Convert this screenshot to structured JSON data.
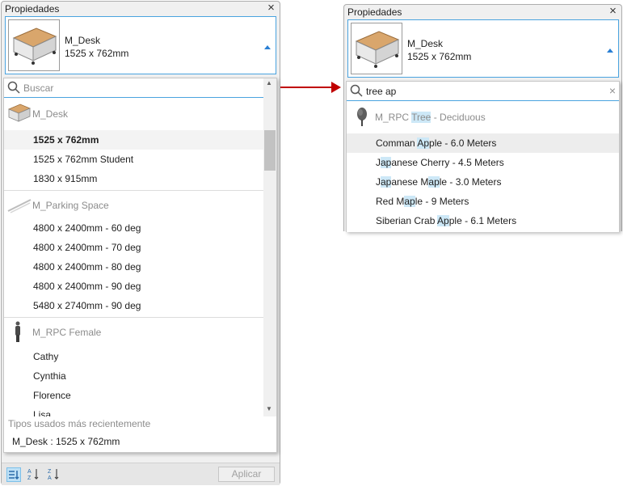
{
  "left": {
    "title": "Propiedades",
    "selected_family": "M_Desk",
    "selected_size": "1525 x 762mm",
    "search_placeholder": "Buscar",
    "groups": [
      {
        "name": "M_Desk",
        "icon": "desk-icon",
        "items": [
          "1525 x 762mm",
          "1525 x 762mm Student",
          "1830 x 915mm"
        ]
      },
      {
        "name": "M_Parking Space",
        "icon": "parking-space-icon",
        "items": [
          "4800 x 2400mm - 60 deg",
          "4800 x 2400mm - 70 deg",
          "4800 x 2400mm - 80 deg",
          "4800 x 2400mm - 90 deg",
          "5480 x 2740mm - 90 deg"
        ]
      },
      {
        "name": "M_RPC Female",
        "icon": "person-icon",
        "items": [
          "Cathy",
          "Cynthia",
          "Florence",
          "Lisa"
        ]
      }
    ],
    "recent_title": "Tipos usados más recientemente",
    "recent_item": "M_Desk : 1525 x 762mm",
    "apply_label": "Aplicar"
  },
  "right": {
    "title": "Propiedades",
    "selected_family": "M_Desk",
    "selected_size": "1525 x 762mm",
    "search_value": "tree ap",
    "group": {
      "prefix": "M_RPC ",
      "match": "Tree",
      "suffix": " - Deciduous",
      "icon": "tree-icon"
    },
    "items": [
      {
        "a": "Comman ",
        "m": "Ap",
        "b": "ple - 6.0 Meters"
      },
      {
        "a": "J",
        "m": "ap",
        "b": "anese Cherry - 4.5 Meters"
      },
      {
        "a": "J",
        "m": "ap",
        "b": "anese M",
        "m2": "ap",
        "c": "le - 3.0 Meters"
      },
      {
        "a": "Red M",
        "m": "ap",
        "b": "le - 9 Meters"
      },
      {
        "a": "Siberian Crab ",
        "m": "Ap",
        "b": "ple - 6.1 Meters"
      }
    ]
  },
  "colors": {
    "accent": "#4aa3df",
    "arrow": "#c00000",
    "highlight": "#cde8f7"
  }
}
